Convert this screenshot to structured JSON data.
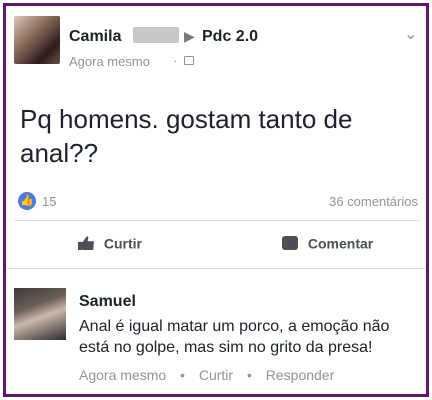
{
  "post": {
    "author": "Camila",
    "group": "Pdc 2.0",
    "time": "Agora mesmo",
    "text": "Pq homens. gostam tanto de anal??",
    "reactions": "15",
    "comments": "36 comentários"
  },
  "actions": {
    "like": "Curtir",
    "comment": "Comentar"
  },
  "comment": {
    "author": "Samuel",
    "text": "Anal é igual matar um porco, a emoção não está no golpe, mas sim no grito da presa!",
    "time": "Agora mesmo",
    "like": "Curtir",
    "reply": "Responder"
  },
  "icons": {
    "like": "thumbs-up-icon",
    "comment": "speech-bubble-icon",
    "group": "group-icon",
    "menu": "chevron-down-icon"
  },
  "colors": {
    "frame": "#5b1a63",
    "like_bubble": "#4c7ae0"
  }
}
